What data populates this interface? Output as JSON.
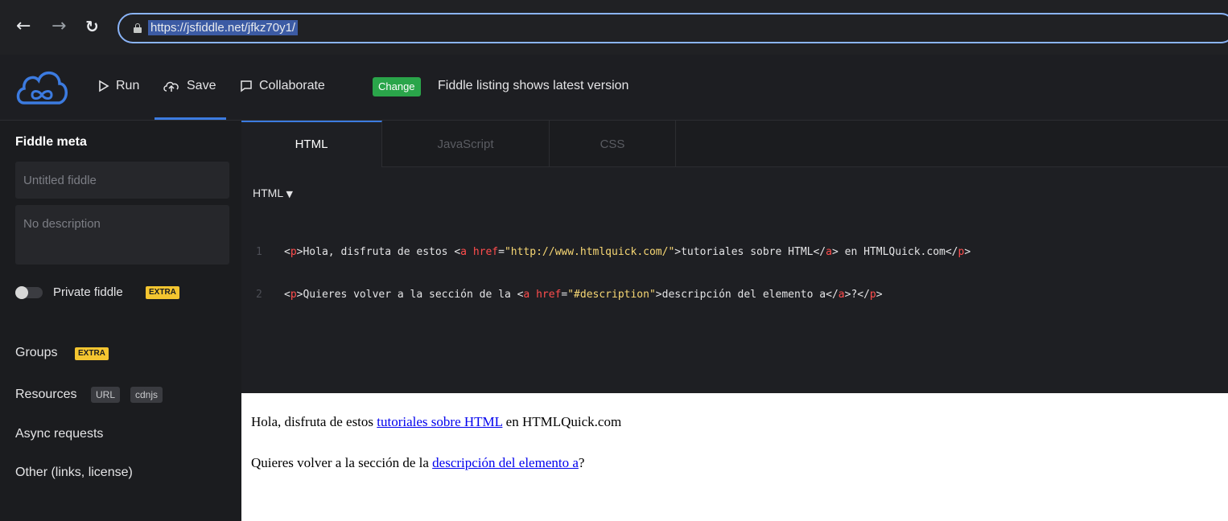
{
  "browser": {
    "url": "https://jsfiddle.net/jfkz70y1/"
  },
  "header": {
    "run_label": "Run",
    "save_label": "Save",
    "collaborate_label": "Collaborate",
    "change_label": "Change",
    "listing_text": "Fiddle listing shows latest version"
  },
  "sidebar": {
    "title": "Fiddle meta",
    "title_placeholder": "Untitled fiddle",
    "description_placeholder": "No description",
    "private_label": "Private fiddle",
    "extra_badge": "EXTRA",
    "groups_label": "Groups",
    "resources_label": "Resources",
    "url_badge": "URL",
    "cdnjs_badge": "cdnjs",
    "async_label": "Async requests",
    "other_label": "Other (links, license)"
  },
  "editor": {
    "tabs": [
      "HTML",
      "JavaScript",
      "CSS"
    ],
    "language": "HTML",
    "code_lines": [
      "<p>Hola, disfruta de estos <a href=\"http://www.htmlquick.com/\">tutoriales sobre HTML</a> en HTMLQuick.com</p>",
      "<p>Quieres volver a la sección de la <a href=\"#description\">descripción del elemento a</a>?</p>"
    ]
  },
  "result": {
    "p1_before": "Hola, disfruta de estos ",
    "p1_link": "tutoriales sobre HTML",
    "p1_after": " en HTMLQuick.com",
    "p2_before": "Quieres volver a la sección de la ",
    "p2_link": "descripción del elemento a",
    "p2_after": "?"
  },
  "colors": {
    "accent": "#3c7be0",
    "change_green": "#2aa54a",
    "extra_yellow": "#f4c530"
  }
}
